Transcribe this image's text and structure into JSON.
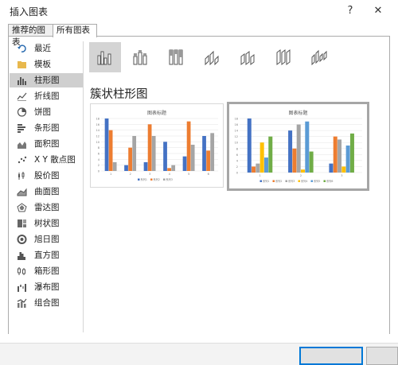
{
  "window": {
    "title": "插入图表",
    "help_label": "?",
    "close_label": "✕"
  },
  "tabs": [
    {
      "label": "推荐的图表",
      "active": false
    },
    {
      "label": "所有图表",
      "active": true
    }
  ],
  "sidebar": {
    "items": [
      {
        "label": "最近",
        "icon": "recent-icon"
      },
      {
        "label": "模板",
        "icon": "folder-icon"
      },
      {
        "label": "柱形图",
        "icon": "column-chart-icon",
        "selected": true
      },
      {
        "label": "折线图",
        "icon": "line-chart-icon"
      },
      {
        "label": "饼图",
        "icon": "pie-chart-icon"
      },
      {
        "label": "条形图",
        "icon": "bar-chart-icon"
      },
      {
        "label": "面积图",
        "icon": "area-chart-icon"
      },
      {
        "label": "X Y 散点图",
        "icon": "scatter-chart-icon"
      },
      {
        "label": "股价图",
        "icon": "stock-chart-icon"
      },
      {
        "label": "曲面图",
        "icon": "surface-chart-icon"
      },
      {
        "label": "雷达图",
        "icon": "radar-chart-icon"
      },
      {
        "label": "树状图",
        "icon": "treemap-chart-icon"
      },
      {
        "label": "旭日图",
        "icon": "sunburst-chart-icon"
      },
      {
        "label": "直方图",
        "icon": "histogram-chart-icon"
      },
      {
        "label": "箱形图",
        "icon": "box-chart-icon"
      },
      {
        "label": "瀑布图",
        "icon": "waterfall-chart-icon"
      },
      {
        "label": "组合图",
        "icon": "combo-chart-icon"
      }
    ]
  },
  "subtypes": [
    {
      "icon": "clustered-column-icon",
      "selected": true
    },
    {
      "icon": "stacked-column-icon"
    },
    {
      "icon": "percent-stacked-column-icon"
    },
    {
      "icon": "3d-clustered-column-icon"
    },
    {
      "icon": "3d-stacked-column-icon"
    },
    {
      "icon": "3d-percent-stacked-column-icon"
    },
    {
      "icon": "3d-column-icon"
    }
  ],
  "main": {
    "subtype_title": "簇状柱形图"
  },
  "colors": {
    "series": [
      "#4472c4",
      "#ed7d31",
      "#a5a5a5",
      "#ffc000",
      "#5b9bd5",
      "#70ad47"
    ]
  },
  "chart_data": [
    {
      "type": "bar",
      "title": "图表标题",
      "categories": [
        "1",
        "2",
        "3",
        "4",
        "5",
        "6"
      ],
      "ylim": [
        0,
        18
      ],
      "yticks": [
        "0",
        "2",
        "4",
        "6",
        "8",
        "10",
        "12",
        "14",
        "16",
        "18"
      ],
      "series": [
        {
          "name": "系列1",
          "values": [
            18,
            2,
            3,
            10,
            5,
            12
          ]
        },
        {
          "name": "系列2",
          "values": [
            14,
            8,
            16,
            1,
            17,
            7
          ]
        },
        {
          "name": "系列3",
          "values": [
            3,
            12,
            12,
            2,
            9,
            13
          ]
        }
      ]
    },
    {
      "type": "bar",
      "title": "图表标题",
      "categories": [
        "1",
        "2",
        "3"
      ],
      "ylim": [
        0,
        18
      ],
      "yticks": [
        "0",
        "2",
        "4",
        "6",
        "8",
        "10",
        "12",
        "14",
        "16",
        "18"
      ],
      "series": [
        {
          "name": "系列1",
          "values": [
            18,
            14,
            3
          ]
        },
        {
          "name": "系列2",
          "values": [
            2,
            8,
            12
          ]
        },
        {
          "name": "系列3",
          "values": [
            3,
            16,
            11
          ]
        },
        {
          "name": "系列4",
          "values": [
            10,
            1,
            2
          ]
        },
        {
          "name": "系列5",
          "values": [
            5,
            17,
            9
          ]
        },
        {
          "name": "系列6",
          "values": [
            12,
            7,
            13
          ]
        }
      ]
    }
  ],
  "footer": {
    "ok_label": "",
    "cancel_label": ""
  }
}
